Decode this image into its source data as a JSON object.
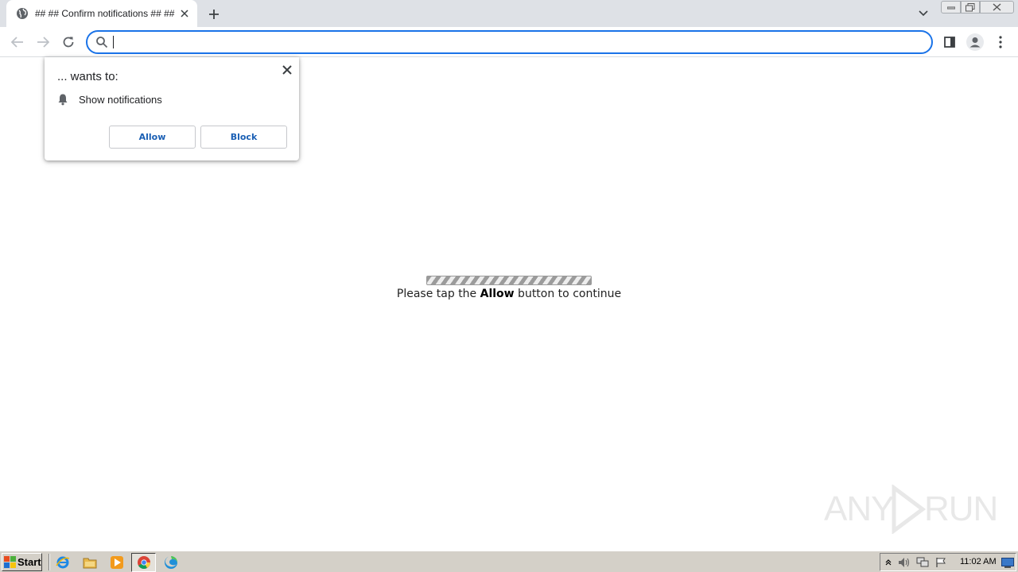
{
  "browser": {
    "tab_title": "## ## Confirm notifications ## ##",
    "omnibox_value": ""
  },
  "permission_popup": {
    "title": "... wants to:",
    "permission_label": "Show notifications",
    "allow_label": "Allow",
    "block_label": "Block"
  },
  "page": {
    "message_prefix": "Please tap the ",
    "message_bold": "Allow",
    "message_suffix": " button to continue"
  },
  "watermark": {
    "left": "ANY",
    "right": "RUN"
  },
  "taskbar": {
    "start_label": "Start",
    "clock": "11:02 AM"
  },
  "colors": {
    "accent": "#1a73e8",
    "tabstrip": "#dee1e6",
    "taskbar": "#d4d0c8",
    "button_text": "#1a5fb4"
  }
}
